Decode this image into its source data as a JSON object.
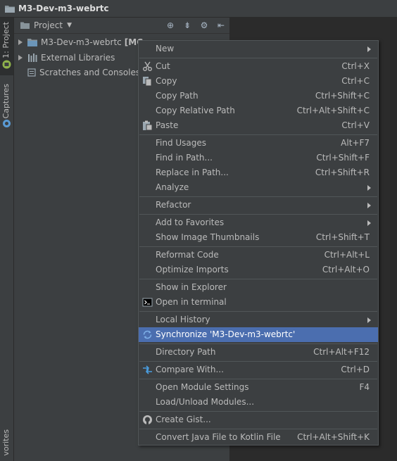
{
  "window": {
    "title": "M3-Dev-m3-webrtc"
  },
  "left_strip": {
    "tabs": [
      {
        "label": "1: Project"
      },
      {
        "label": "Captures"
      },
      {
        "label": "vorites"
      }
    ]
  },
  "project_panel": {
    "header_title": "Project",
    "tree": [
      {
        "label": "M3-Dev-m3-webrtc",
        "suffix": "[MC"
      },
      {
        "label": "External Libraries"
      },
      {
        "label": "Scratches and Consoles"
      }
    ]
  },
  "context_menu": {
    "items": [
      {
        "label": "New",
        "shortcut": "",
        "submenu": true
      },
      {
        "label": "Cut",
        "shortcut": "Ctrl+X"
      },
      {
        "label": "Copy",
        "shortcut": "Ctrl+C"
      },
      {
        "label": "Copy Path",
        "shortcut": "Ctrl+Shift+C"
      },
      {
        "label": "Copy Relative Path",
        "shortcut": "Ctrl+Alt+Shift+C"
      },
      {
        "label": "Paste",
        "shortcut": "Ctrl+V"
      },
      {
        "label": "Find Usages",
        "shortcut": "Alt+F7"
      },
      {
        "label": "Find in Path...",
        "shortcut": "Ctrl+Shift+F"
      },
      {
        "label": "Replace in Path...",
        "shortcut": "Ctrl+Shift+R"
      },
      {
        "label": "Analyze",
        "shortcut": "",
        "submenu": true
      },
      {
        "label": "Refactor",
        "shortcut": "",
        "submenu": true
      },
      {
        "label": "Add to Favorites",
        "shortcut": "",
        "submenu": true
      },
      {
        "label": "Show Image Thumbnails",
        "shortcut": "Ctrl+Shift+T"
      },
      {
        "label": "Reformat Code",
        "shortcut": "Ctrl+Alt+L"
      },
      {
        "label": "Optimize Imports",
        "shortcut": "Ctrl+Alt+O"
      },
      {
        "label": "Show in Explorer",
        "shortcut": ""
      },
      {
        "label": "Open in terminal",
        "shortcut": ""
      },
      {
        "label": "Local History",
        "shortcut": "",
        "submenu": true
      },
      {
        "label": "Synchronize 'M3-Dev-m3-webrtc'",
        "shortcut": "",
        "selected": true
      },
      {
        "label": "Directory Path",
        "shortcut": "Ctrl+Alt+F12"
      },
      {
        "label": "Compare With...",
        "shortcut": "Ctrl+D"
      },
      {
        "label": "Open Module Settings",
        "shortcut": "F4"
      },
      {
        "label": "Load/Unload Modules...",
        "shortcut": ""
      },
      {
        "label": "Create Gist...",
        "shortcut": ""
      },
      {
        "label": "Convert Java File to Kotlin File",
        "shortcut": "Ctrl+Alt+Shift+K"
      }
    ]
  },
  "colors": {
    "background": "#2b2b2b",
    "panel": "#3c3f41",
    "selection": "#4b6eaf",
    "text": "#bbbbbb"
  }
}
